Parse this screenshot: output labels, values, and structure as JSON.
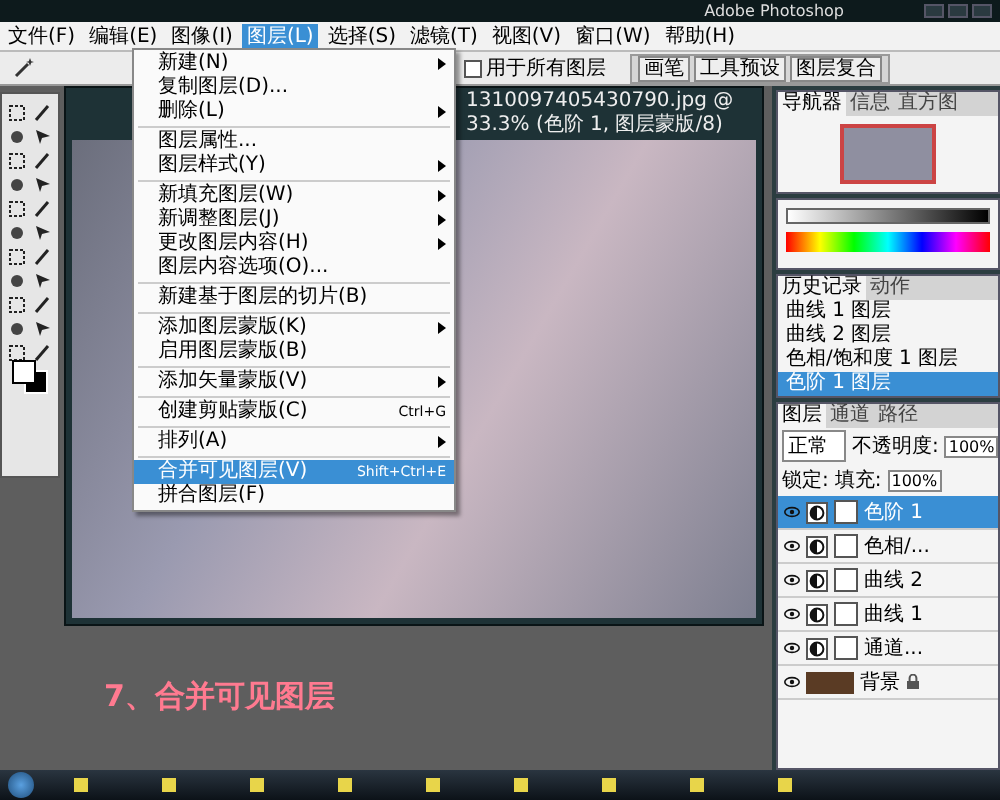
{
  "window": {
    "title": "Adobe Photoshop"
  },
  "menu_bar": [
    {
      "label": "文件(F)",
      "selected": false
    },
    {
      "label": "编辑(E)",
      "selected": false
    },
    {
      "label": "图像(I)",
      "selected": false
    },
    {
      "label": "图层(L)",
      "selected": true
    },
    {
      "label": "选择(S)",
      "selected": false
    },
    {
      "label": "滤镜(T)",
      "selected": false
    },
    {
      "label": "视图(V)",
      "selected": false
    },
    {
      "label": "窗口(W)",
      "selected": false
    },
    {
      "label": "帮助(H)",
      "selected": false
    }
  ],
  "layer_menu": [
    {
      "kind": "item",
      "label": "新建(N)",
      "submenu": true,
      "disabled": false,
      "selected": false
    },
    {
      "kind": "item",
      "label": "复制图层(D)...",
      "submenu": false,
      "disabled": false,
      "selected": false
    },
    {
      "kind": "item",
      "label": "删除(L)",
      "submenu": true,
      "disabled": false,
      "selected": false
    },
    {
      "kind": "separator"
    },
    {
      "kind": "item",
      "label": "图层属性...",
      "submenu": false,
      "disabled": false,
      "selected": false
    },
    {
      "kind": "item",
      "label": "图层样式(Y)",
      "submenu": true,
      "disabled": false,
      "selected": false
    },
    {
      "kind": "separator"
    },
    {
      "kind": "item",
      "label": "新填充图层(W)",
      "submenu": true,
      "disabled": false,
      "selected": false
    },
    {
      "kind": "item",
      "label": "新调整图层(J)",
      "submenu": true,
      "disabled": false,
      "selected": false
    },
    {
      "kind": "item",
      "label": "更改图层内容(H)",
      "submenu": true,
      "disabled": false,
      "selected": false
    },
    {
      "kind": "item",
      "label": "图层内容选项(O)...",
      "submenu": false,
      "disabled": false,
      "selected": false
    },
    {
      "kind": "separator"
    },
    {
      "kind": "item",
      "label": "新建基于图层的切片(B)",
      "submenu": false,
      "disabled": false,
      "selected": false
    },
    {
      "kind": "separator"
    },
    {
      "kind": "item",
      "label": "添加图层蒙版(K)",
      "submenu": true,
      "disabled": false,
      "selected": false
    },
    {
      "kind": "item",
      "label": "启用图层蒙版(B)",
      "submenu": false,
      "disabled": false,
      "selected": false
    },
    {
      "kind": "separator"
    },
    {
      "kind": "item",
      "label": "添加矢量蒙版(V)",
      "submenu": true,
      "disabled": false,
      "selected": false
    },
    {
      "kind": "separator"
    },
    {
      "kind": "item",
      "label": "创建剪贴蒙版(C)",
      "shortcut": "Ctrl+G",
      "submenu": false,
      "disabled": false,
      "selected": false
    },
    {
      "kind": "separator"
    },
    {
      "kind": "item",
      "label": "排列(A)",
      "submenu": true,
      "disabled": false,
      "selected": false
    },
    {
      "kind": "separator"
    },
    {
      "kind": "item",
      "label": "合并可见图层(V)",
      "shortcut": "Shift+Ctrl+E",
      "submenu": false,
      "disabled": false,
      "selected": true
    },
    {
      "kind": "item",
      "label": "拼合图层(F)",
      "submenu": false,
      "disabled": false,
      "selected": false
    }
  ],
  "options_bar": {
    "checkbox_label": "用于所有图层",
    "checked": false,
    "tabs": [
      "画笔",
      "工具预设",
      "图层复合"
    ]
  },
  "document": {
    "title": "1310097405430790.jpg @ 33.3% (色阶 1, 图层蒙版/8)"
  },
  "navigator": {
    "tabs": [
      {
        "label": "导航器",
        "selected": true
      },
      {
        "label": "信息",
        "selected": false
      },
      {
        "label": "直方图",
        "selected": false
      }
    ]
  },
  "history": {
    "tabs": [
      {
        "label": "历史记录",
        "selected": true
      },
      {
        "label": "动作",
        "selected": false
      }
    ],
    "items": [
      {
        "label": "曲线 1 图层",
        "selected": false
      },
      {
        "label": "曲线 2 图层",
        "selected": false
      },
      {
        "label": "色相/饱和度 1 图层",
        "selected": false
      },
      {
        "label": "色阶 1 图层",
        "selected": true
      }
    ]
  },
  "layers": {
    "tabs": [
      {
        "label": "图层",
        "selected": true
      },
      {
        "label": "通道",
        "selected": false
      },
      {
        "label": "路径",
        "selected": false
      }
    ],
    "blend_mode": "正常",
    "opacity_label": "不透明度:",
    "opacity": "100%",
    "lock_label": "锁定:",
    "fill_label": "填充:",
    "fill": "100%",
    "items": [
      {
        "name": "色阶 1",
        "kind": "adjustment",
        "selected": true,
        "locked": false
      },
      {
        "name": "色相/...",
        "kind": "adjustment",
        "selected": false,
        "locked": false
      },
      {
        "name": "曲线 2",
        "kind": "adjustment",
        "selected": false,
        "locked": false
      },
      {
        "name": "曲线 1",
        "kind": "adjustment",
        "selected": false,
        "locked": false
      },
      {
        "name": "通道...",
        "kind": "adjustment",
        "selected": false,
        "locked": false
      },
      {
        "name": "背景",
        "kind": "image",
        "selected": false,
        "locked": true
      }
    ]
  },
  "caption": "7、合并可见图层"
}
